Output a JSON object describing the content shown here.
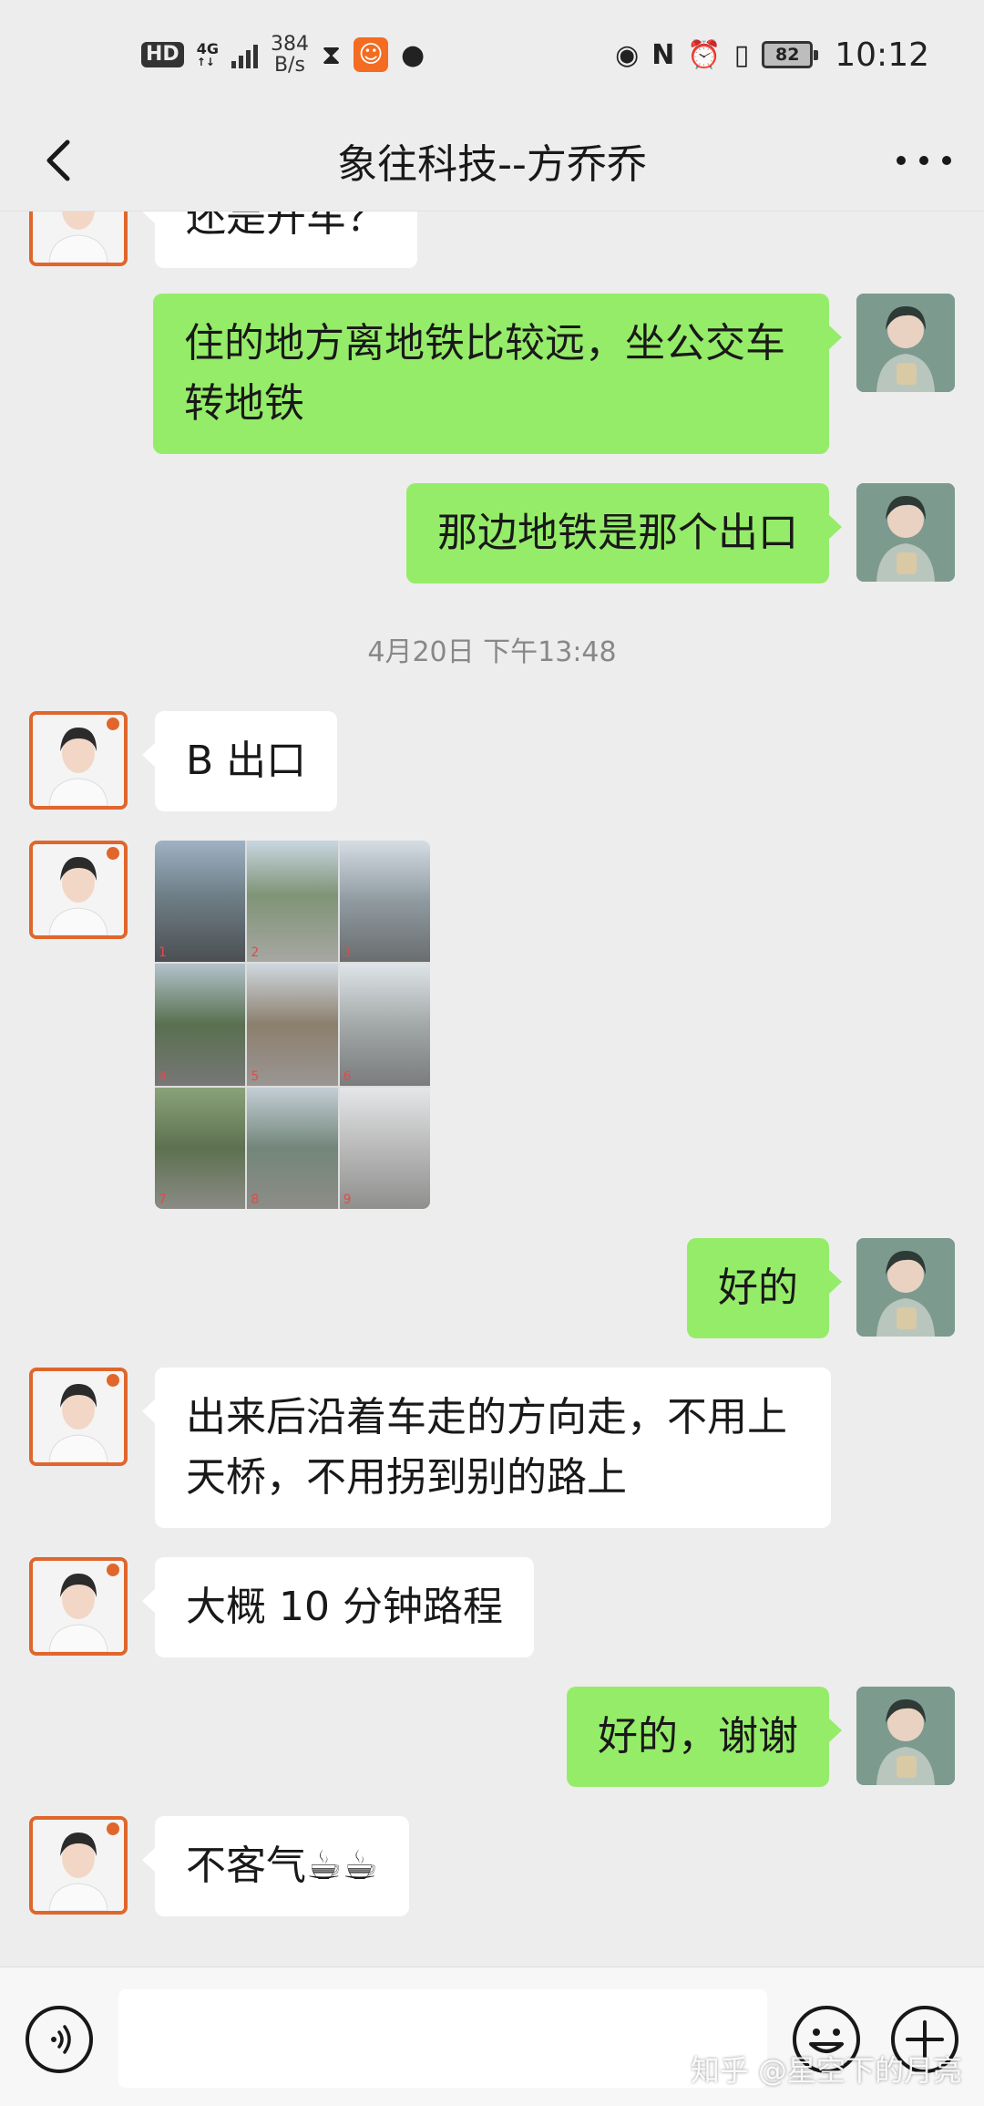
{
  "status_bar": {
    "hd": "HD",
    "network": "4G",
    "speed_value": "384",
    "speed_unit": "B/s",
    "battery": "82",
    "time": "10:12"
  },
  "header": {
    "title": "象往科技--方乔乔"
  },
  "messages": [
    {
      "side": "left",
      "text": "还是开车？"
    },
    {
      "side": "right",
      "text": "住的地方离地铁比较远，坐公交车\n转地铁"
    },
    {
      "side": "right",
      "text": "那边地铁是那个出口"
    },
    {
      "type": "time",
      "text": "4月20日 下午13:48"
    },
    {
      "side": "left",
      "text": "B 出口"
    },
    {
      "side": "left",
      "type": "image",
      "image_numbers": [
        "1",
        "2",
        "3",
        "4",
        "5",
        "6",
        "7",
        "8",
        "9"
      ]
    },
    {
      "side": "right",
      "text": "好的"
    },
    {
      "side": "left",
      "text": "出来后沿着车走的方向走，不用上\n天桥，不用拐到别的路上"
    },
    {
      "side": "left",
      "text": "大概 10 分钟路程"
    },
    {
      "side": "right",
      "text": "好的，谢谢"
    },
    {
      "side": "left",
      "text": "不客气☕☕"
    }
  ],
  "input_bar": {
    "placeholder": "",
    "watermark": "知乎 @星空下的月亮"
  },
  "colors": {
    "background": "#ededed",
    "bubble_self": "#95ec69",
    "bubble_other": "#ffffff",
    "avatar_border": "#e0662c"
  }
}
